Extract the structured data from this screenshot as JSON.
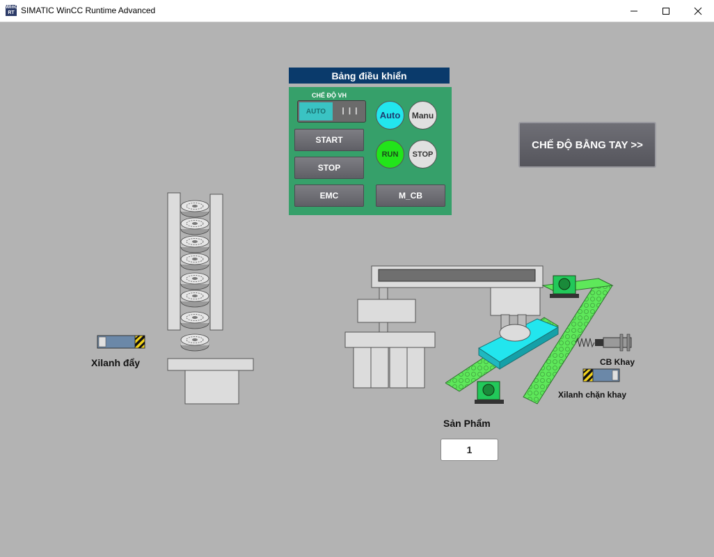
{
  "window": {
    "title": "SIMATIC WinCC Runtime Advanced",
    "icon_text": "WinCC RT",
    "controls": [
      "minimize-icon",
      "maximize-icon",
      "close-icon"
    ]
  },
  "control_panel": {
    "title": "Bảng điều khiển",
    "mode_label": "CHẾ ĐỘ VH",
    "toggle_auto_label": "AUTO",
    "toggle_grip": "❙❙❙",
    "start_label": "START",
    "stop_label": "STOP",
    "emc_label": "EMC",
    "mcb_label": "M_CB",
    "indicator_auto": "Auto",
    "indicator_manu": "Manu",
    "indicator_run": "RUN",
    "indicator_stop": "STOP"
  },
  "manual_mode_button": "CHẾ ĐỘ BẰNG TAY >>",
  "labels": {
    "push_cylinder": "Xilanh đẩy",
    "tray_sensor": "CB Khay",
    "tray_stop_cylinder": "Xilanh chặn khay",
    "product": "Sản Phẩm"
  },
  "product_count": "1",
  "colors": {
    "background": "#b3b3b3",
    "panel_green": "#36a06a",
    "panel_header": "#0a3a6b",
    "indicator_active_auto": "#22e6ee",
    "indicator_active_run": "#22e41a",
    "indicator_inactive": "#e0e0e0",
    "conveyor": "#5ee85a",
    "workpiece": "#22e6ee"
  }
}
